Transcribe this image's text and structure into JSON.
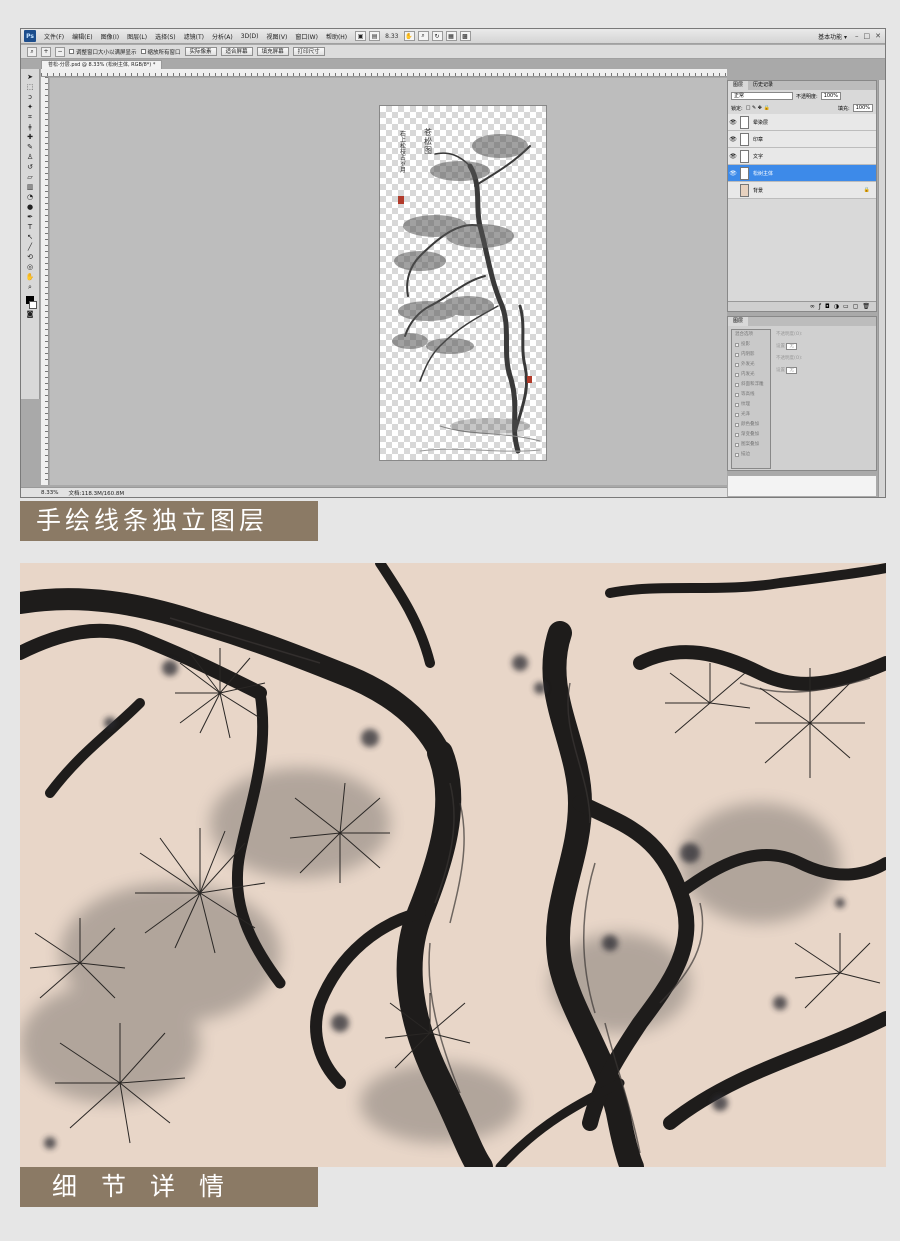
{
  "menubar": {
    "logo": "Ps",
    "items": [
      "文件(F)",
      "编辑(E)",
      "图像(I)",
      "图层(L)",
      "选择(S)",
      "滤镜(T)",
      "分析(A)",
      "3D(D)",
      "视图(V)",
      "窗口(W)",
      "帮助(H)"
    ],
    "zoom": "8.33",
    "workspace": "基本功能 ▾"
  },
  "options": {
    "checkboxes": [
      "调整窗口大小以满屏显示",
      "缩放所有窗口"
    ],
    "buttons": [
      "实际像素",
      "适合屏幕",
      "填充屏幕",
      "打印尺寸"
    ]
  },
  "document": {
    "tab": "苍松-分层.psd @ 8.33% (松树主体, RGB/8*) *",
    "zoom": "8.33%",
    "doc_info": "文档:118.3M/160.8M",
    "poem_title": "苍松图",
    "poem_line": "石上松枝占岁月"
  },
  "layers_panel": {
    "tabs": [
      "图层",
      "历史记录"
    ],
    "blend_mode": "正常",
    "opacity_label": "不透明度:",
    "opacity": "100%",
    "lock_label": "锁定:",
    "fill_label": "填充:",
    "fill": "100%",
    "layers": [
      {
        "name": "晕染层",
        "visible": true,
        "selected": false
      },
      {
        "name": "印章",
        "visible": true,
        "selected": false
      },
      {
        "name": "文字",
        "visible": true,
        "selected": false
      },
      {
        "name": "松树主体",
        "visible": true,
        "selected": true
      },
      {
        "name": "背景",
        "visible": false,
        "selected": false
      }
    ]
  },
  "styles_panel": {
    "tab": "图层",
    "items": [
      "混合选项",
      "投影",
      "内阴影",
      "外发光",
      "内发光",
      "斜面和浮雕",
      "等高线",
      "纹理",
      "光泽",
      "颜色叠加",
      "渐变叠加",
      "图案叠加",
      "描边"
    ],
    "options": [
      "不透明度(O):",
      "设置",
      "不透明度(O):",
      "设置"
    ],
    "option_values": [
      "无",
      "无"
    ]
  },
  "captions": {
    "top": "手绘线条独立图层",
    "bottom": "细节详情"
  },
  "colors": {
    "caption_bg": "#8b7a65",
    "detail_bg": "#e8d6c8",
    "layer_selected": "#3d8ae9",
    "seal_red": "#b23a2a"
  }
}
